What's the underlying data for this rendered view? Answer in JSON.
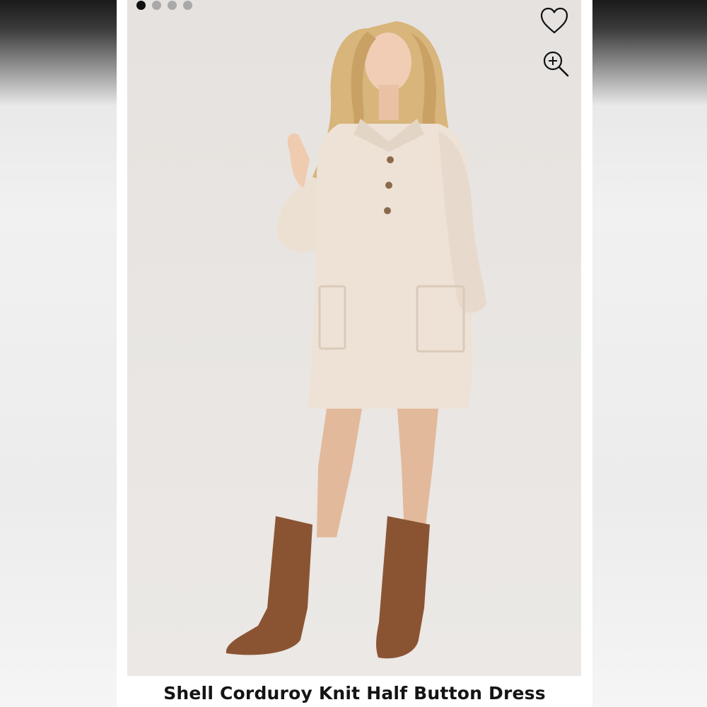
{
  "carousel": {
    "slide_count": 4,
    "active_index": 0
  },
  "actions": {
    "like_icon": "heart-outline-icon",
    "zoom_icon": "zoom-in-icon"
  },
  "product": {
    "title": "Shell Corduroy Knit Half Button Dress"
  },
  "colors": {
    "dress": "#eee2d6",
    "boots": "#8a5433",
    "background": "#e8e5e2"
  }
}
